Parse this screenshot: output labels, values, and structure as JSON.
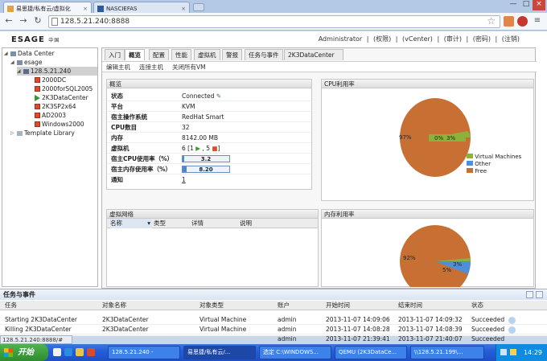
{
  "browser": {
    "tabs": [
      {
        "label": "易思捷/私有云/虚拟化",
        "active": true
      },
      {
        "label": "NASCIEFAS",
        "active": false
      }
    ],
    "url": "128.5.21.240:8888",
    "window_controls": [
      "—",
      "□",
      "×"
    ]
  },
  "app": {
    "logo": "ESAGE",
    "logo_sub": "中国",
    "top_links": "Administrator | (权限) | (vCenter) | (审计) | (密码) | (注销)"
  },
  "tree": {
    "datacenter": "Data Center",
    "esage": "esage",
    "host": "128.5.21.240",
    "vms": [
      {
        "name": "2000DC",
        "state": "stopped"
      },
      {
        "name": "2000forSQL2005",
        "state": "stopped"
      },
      {
        "name": "2K3DataCenter",
        "state": "running"
      },
      {
        "name": "2K3SP2x64",
        "state": "stopped"
      },
      {
        "name": "AD2003",
        "state": "stopped"
      },
      {
        "name": "Windows2000",
        "state": "stopped"
      }
    ],
    "template_library": "Template Library"
  },
  "main_tabs": [
    {
      "label": "入门"
    },
    {
      "label": "概览"
    },
    {
      "label": "配置"
    },
    {
      "label": "性能"
    },
    {
      "label": "虚拟机"
    },
    {
      "label": "警报"
    },
    {
      "label": "任务与事件"
    },
    {
      "label": "2K3DataCenter"
    }
  ],
  "actions": [
    "编辑主机",
    "连接主机",
    "关闭所有VM"
  ],
  "overview": {
    "title": "概览",
    "rows": [
      {
        "key": "状态",
        "value": "Connected"
      },
      {
        "key": "平台",
        "value": "KVM"
      },
      {
        "key": "宿主操作系统",
        "value": "RedHat Smart"
      },
      {
        "key": "CPU数目",
        "value": "32"
      },
      {
        "key": "内存",
        "value": "8142.00 MB"
      },
      {
        "key": "虚拟机",
        "value": "6 [1",
        "value2": ", 5"
      },
      {
        "key": "宿主CPU使用率（%）",
        "bar_label": "3.2",
        "bar_value": 0.032
      },
      {
        "key": "宿主内存使用率（%）",
        "bar_label": "8.20",
        "bar_value": 0.082
      },
      {
        "key": "通知",
        "value": "1"
      }
    ]
  },
  "cpu_panel": {
    "title": "CPU利用率",
    "labels": {
      "free": "97%",
      "vm": "0%",
      "other": "3%"
    },
    "legend": [
      {
        "name": "Virtual Machines",
        "color": "#8bb33c"
      },
      {
        "name": "Other",
        "color": "#4f8fda"
      },
      {
        "name": "Free",
        "color": "#c87034"
      }
    ]
  },
  "network_panel": {
    "title": "虚拟网络",
    "columns": [
      "名称",
      "类型",
      "详情",
      "说明"
    ]
  },
  "mem_panel": {
    "title": "内存利用率",
    "labels": {
      "free": "92%",
      "vm": "3%",
      "other": "5%"
    }
  },
  "tasks": {
    "title": "任务与事件",
    "columns": [
      "任务",
      "对象名称",
      "对象类型",
      "账户",
      "开始时间",
      "结束时间",
      "状态"
    ],
    "rows": [
      [
        "Starting 2K3DataCenter",
        "2K3DataCenter",
        "Virtual Machine",
        "admin",
        "2013-11-07 14:09:06",
        "2013-11-07 14:09:32",
        "Succeeded"
      ],
      [
        "Killing 2K3DataCenter",
        "2K3DataCenter",
        "Virtual Machine",
        "admin",
        "2013-11-07 14:08:28",
        "2013-11-07 14:08:39",
        "Succeeded"
      ],
      [
        "",
        "",
        "",
        "admin",
        "2013-11-07 21:39:41",
        "2013-11-07 21:40:07",
        "Succeeded"
      ]
    ]
  },
  "statusbar": "128.5.21.240:8888/#",
  "taskbar": {
    "start": "开始",
    "items": [
      {
        "label": "128.5.21.240 -"
      },
      {
        "label": "易思捷/私有云/..."
      },
      {
        "label": "选定 C:\\WINDOWS..."
      },
      {
        "label": "QEMU (2K3DataCe..."
      },
      {
        "label": "\\\\128.5.21.199\\..."
      }
    ],
    "clock": "14:29"
  }
}
